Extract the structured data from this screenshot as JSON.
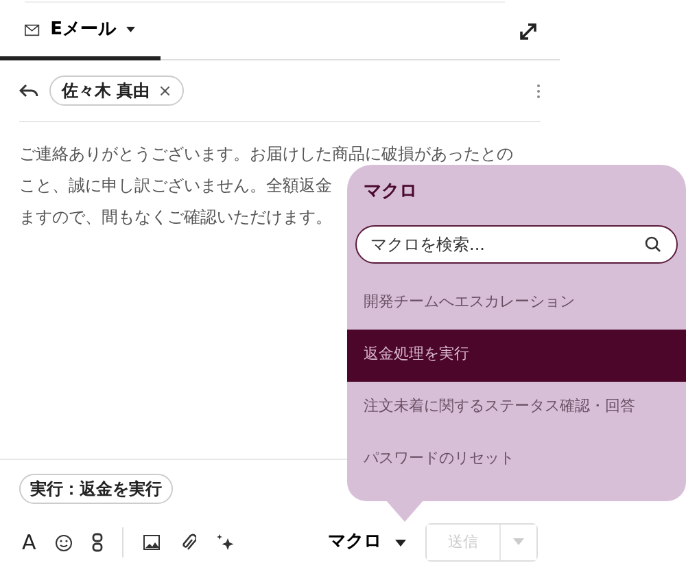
{
  "tabs": [
    {
      "label": "Eメール",
      "selected": true
    }
  ],
  "recipients": [
    {
      "name": "佐々木 真由",
      "remove": "×"
    }
  ],
  "body_lines": [
    "ご連絡ありがとうございます。お届けした商品に破損があったとの",
    "こと、誠に申し訳ございません。全額返金",
    "ますので、間もなくご確認いただけます。"
  ],
  "applied_macro": "実行：返金を実行",
  "format_icon": "A",
  "macro_button": {
    "label": "マクロ"
  },
  "send_button": {
    "label": "送信",
    "disabled": true
  },
  "macro_popover": {
    "title": "マクロ",
    "search": {
      "placeholder": "マクロを検索..."
    },
    "items": [
      {
        "label": "開発チームへエスカレーション",
        "selected": false
      },
      {
        "label": "返金処理を実行",
        "selected": true
      },
      {
        "label": "注文未着に関するステータス確認・回答",
        "selected": false
      },
      {
        "label": "パスワードのリセット",
        "selected": false
      }
    ]
  }
}
